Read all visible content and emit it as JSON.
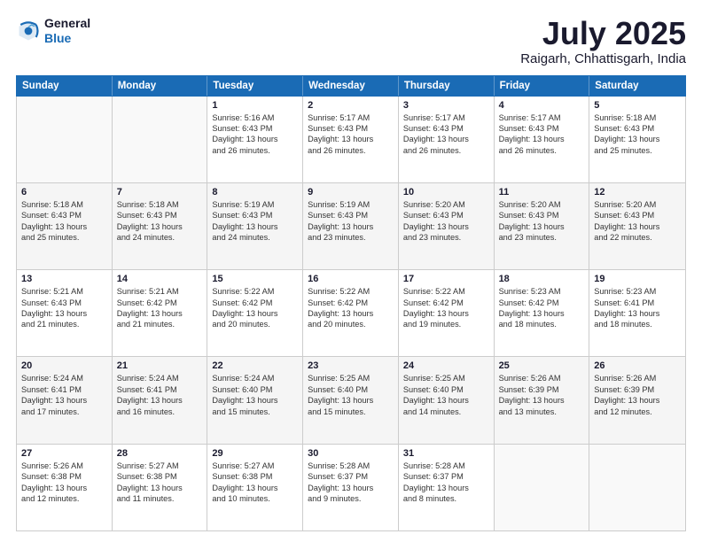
{
  "logo": {
    "line1": "General",
    "line2": "Blue"
  },
  "title": "July 2025",
  "subtitle": "Raigarh, Chhattisgarh, India",
  "headers": [
    "Sunday",
    "Monday",
    "Tuesday",
    "Wednesday",
    "Thursday",
    "Friday",
    "Saturday"
  ],
  "weeks": [
    [
      {
        "day": "",
        "lines": []
      },
      {
        "day": "",
        "lines": []
      },
      {
        "day": "1",
        "lines": [
          "Sunrise: 5:16 AM",
          "Sunset: 6:43 PM",
          "Daylight: 13 hours",
          "and 26 minutes."
        ]
      },
      {
        "day": "2",
        "lines": [
          "Sunrise: 5:17 AM",
          "Sunset: 6:43 PM",
          "Daylight: 13 hours",
          "and 26 minutes."
        ]
      },
      {
        "day": "3",
        "lines": [
          "Sunrise: 5:17 AM",
          "Sunset: 6:43 PM",
          "Daylight: 13 hours",
          "and 26 minutes."
        ]
      },
      {
        "day": "4",
        "lines": [
          "Sunrise: 5:17 AM",
          "Sunset: 6:43 PM",
          "Daylight: 13 hours",
          "and 26 minutes."
        ]
      },
      {
        "day": "5",
        "lines": [
          "Sunrise: 5:18 AM",
          "Sunset: 6:43 PM",
          "Daylight: 13 hours",
          "and 25 minutes."
        ]
      }
    ],
    [
      {
        "day": "6",
        "lines": [
          "Sunrise: 5:18 AM",
          "Sunset: 6:43 PM",
          "Daylight: 13 hours",
          "and 25 minutes."
        ]
      },
      {
        "day": "7",
        "lines": [
          "Sunrise: 5:18 AM",
          "Sunset: 6:43 PM",
          "Daylight: 13 hours",
          "and 24 minutes."
        ]
      },
      {
        "day": "8",
        "lines": [
          "Sunrise: 5:19 AM",
          "Sunset: 6:43 PM",
          "Daylight: 13 hours",
          "and 24 minutes."
        ]
      },
      {
        "day": "9",
        "lines": [
          "Sunrise: 5:19 AM",
          "Sunset: 6:43 PM",
          "Daylight: 13 hours",
          "and 23 minutes."
        ]
      },
      {
        "day": "10",
        "lines": [
          "Sunrise: 5:20 AM",
          "Sunset: 6:43 PM",
          "Daylight: 13 hours",
          "and 23 minutes."
        ]
      },
      {
        "day": "11",
        "lines": [
          "Sunrise: 5:20 AM",
          "Sunset: 6:43 PM",
          "Daylight: 13 hours",
          "and 23 minutes."
        ]
      },
      {
        "day": "12",
        "lines": [
          "Sunrise: 5:20 AM",
          "Sunset: 6:43 PM",
          "Daylight: 13 hours",
          "and 22 minutes."
        ]
      }
    ],
    [
      {
        "day": "13",
        "lines": [
          "Sunrise: 5:21 AM",
          "Sunset: 6:43 PM",
          "Daylight: 13 hours",
          "and 21 minutes."
        ]
      },
      {
        "day": "14",
        "lines": [
          "Sunrise: 5:21 AM",
          "Sunset: 6:42 PM",
          "Daylight: 13 hours",
          "and 21 minutes."
        ]
      },
      {
        "day": "15",
        "lines": [
          "Sunrise: 5:22 AM",
          "Sunset: 6:42 PM",
          "Daylight: 13 hours",
          "and 20 minutes."
        ]
      },
      {
        "day": "16",
        "lines": [
          "Sunrise: 5:22 AM",
          "Sunset: 6:42 PM",
          "Daylight: 13 hours",
          "and 20 minutes."
        ]
      },
      {
        "day": "17",
        "lines": [
          "Sunrise: 5:22 AM",
          "Sunset: 6:42 PM",
          "Daylight: 13 hours",
          "and 19 minutes."
        ]
      },
      {
        "day": "18",
        "lines": [
          "Sunrise: 5:23 AM",
          "Sunset: 6:42 PM",
          "Daylight: 13 hours",
          "and 18 minutes."
        ]
      },
      {
        "day": "19",
        "lines": [
          "Sunrise: 5:23 AM",
          "Sunset: 6:41 PM",
          "Daylight: 13 hours",
          "and 18 minutes."
        ]
      }
    ],
    [
      {
        "day": "20",
        "lines": [
          "Sunrise: 5:24 AM",
          "Sunset: 6:41 PM",
          "Daylight: 13 hours",
          "and 17 minutes."
        ]
      },
      {
        "day": "21",
        "lines": [
          "Sunrise: 5:24 AM",
          "Sunset: 6:41 PM",
          "Daylight: 13 hours",
          "and 16 minutes."
        ]
      },
      {
        "day": "22",
        "lines": [
          "Sunrise: 5:24 AM",
          "Sunset: 6:40 PM",
          "Daylight: 13 hours",
          "and 15 minutes."
        ]
      },
      {
        "day": "23",
        "lines": [
          "Sunrise: 5:25 AM",
          "Sunset: 6:40 PM",
          "Daylight: 13 hours",
          "and 15 minutes."
        ]
      },
      {
        "day": "24",
        "lines": [
          "Sunrise: 5:25 AM",
          "Sunset: 6:40 PM",
          "Daylight: 13 hours",
          "and 14 minutes."
        ]
      },
      {
        "day": "25",
        "lines": [
          "Sunrise: 5:26 AM",
          "Sunset: 6:39 PM",
          "Daylight: 13 hours",
          "and 13 minutes."
        ]
      },
      {
        "day": "26",
        "lines": [
          "Sunrise: 5:26 AM",
          "Sunset: 6:39 PM",
          "Daylight: 13 hours",
          "and 12 minutes."
        ]
      }
    ],
    [
      {
        "day": "27",
        "lines": [
          "Sunrise: 5:26 AM",
          "Sunset: 6:38 PM",
          "Daylight: 13 hours",
          "and 12 minutes."
        ]
      },
      {
        "day": "28",
        "lines": [
          "Sunrise: 5:27 AM",
          "Sunset: 6:38 PM",
          "Daylight: 13 hours",
          "and 11 minutes."
        ]
      },
      {
        "day": "29",
        "lines": [
          "Sunrise: 5:27 AM",
          "Sunset: 6:38 PM",
          "Daylight: 13 hours",
          "and 10 minutes."
        ]
      },
      {
        "day": "30",
        "lines": [
          "Sunrise: 5:28 AM",
          "Sunset: 6:37 PM",
          "Daylight: 13 hours",
          "and 9 minutes."
        ]
      },
      {
        "day": "31",
        "lines": [
          "Sunrise: 5:28 AM",
          "Sunset: 6:37 PM",
          "Daylight: 13 hours",
          "and 8 minutes."
        ]
      },
      {
        "day": "",
        "lines": []
      },
      {
        "day": "",
        "lines": []
      }
    ]
  ]
}
